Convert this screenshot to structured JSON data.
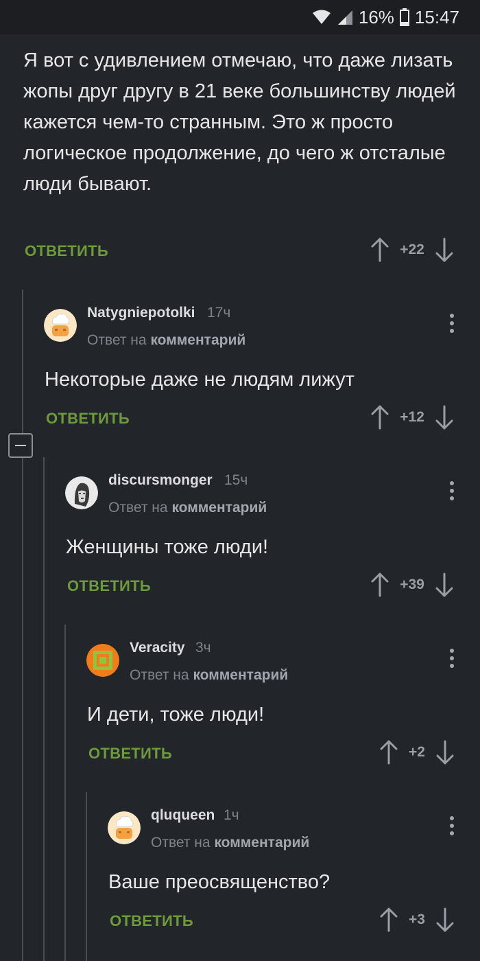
{
  "status_bar": {
    "battery": "16%",
    "time": "15:47"
  },
  "root_comment": {
    "text": "Я вот с удивлением отмечаю, что даже лизать жопы друг другу в 21 веке большинству людей кажется чем-то странным. Это ж просто логическое продолжение, до чего ж отсталые люди бывают.",
    "reply_label": "ОТВЕТИТЬ",
    "score": "+22"
  },
  "comments": [
    {
      "username": "Natygniepotolki",
      "time": "17ч",
      "answer_prefix": "Ответ на",
      "answer_target": "комментарий",
      "text": "Некоторые даже не людям лижут",
      "reply_label": "ОТВЕТИТЬ",
      "score": "+12",
      "avatar": "chef-avatar"
    },
    {
      "username": "discursmonger",
      "time": "15ч",
      "answer_prefix": "Ответ на",
      "answer_target": "комментарий",
      "text": "Женщины тоже люди!",
      "reply_label": "ОТВЕТИТЬ",
      "score": "+39",
      "avatar": "sketch-face-avatar"
    },
    {
      "username": "Veracity",
      "time": "3ч",
      "answer_prefix": "Ответ на",
      "answer_target": "комментарий",
      "text": "И дети, тоже люди!",
      "reply_label": "ОТВЕТИТЬ",
      "score": "+2",
      "avatar": "orange-green-square-avatar"
    },
    {
      "username": "qluqueen",
      "time": "1ч",
      "answer_prefix": "Ответ на",
      "answer_target": "комментарий",
      "text": "Ваше преосвященство?",
      "reply_label": "ОТВЕТИТЬ",
      "score": "+3",
      "avatar": "chef-avatar"
    }
  ],
  "colors": {
    "background": "#22252a",
    "reply_green": "#6e9b3a",
    "muted_text": "#7f838a"
  }
}
